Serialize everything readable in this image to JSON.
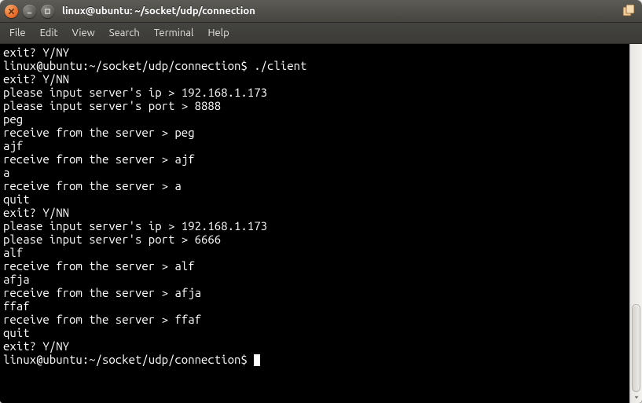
{
  "window": {
    "title": "linux@ubuntu: ~/socket/udp/connection"
  },
  "menubar": {
    "items": [
      "File",
      "Edit",
      "View",
      "Search",
      "Terminal",
      "Help"
    ]
  },
  "terminal": {
    "lines": [
      "exit? Y/NY",
      "linux@ubuntu:~/socket/udp/connection$ ./client",
      "exit? Y/NN",
      "please input server's ip > 192.168.1.173",
      "please input server's port > 8888",
      "peg",
      "receive from the server > peg",
      "ajf",
      "receive from the server > ajf",
      "a",
      "receive from the server > a",
      "quit",
      "exit? Y/NN",
      "please input server's ip > 192.168.1.173",
      "please input server's port > 6666",
      "alf",
      "receive from the server > alf",
      "afja",
      "receive from the server > afja",
      "ffaf",
      "receive from the server > ffaf",
      "quit",
      "exit? Y/NY",
      "linux@ubuntu:~/socket/udp/connection$ "
    ]
  }
}
